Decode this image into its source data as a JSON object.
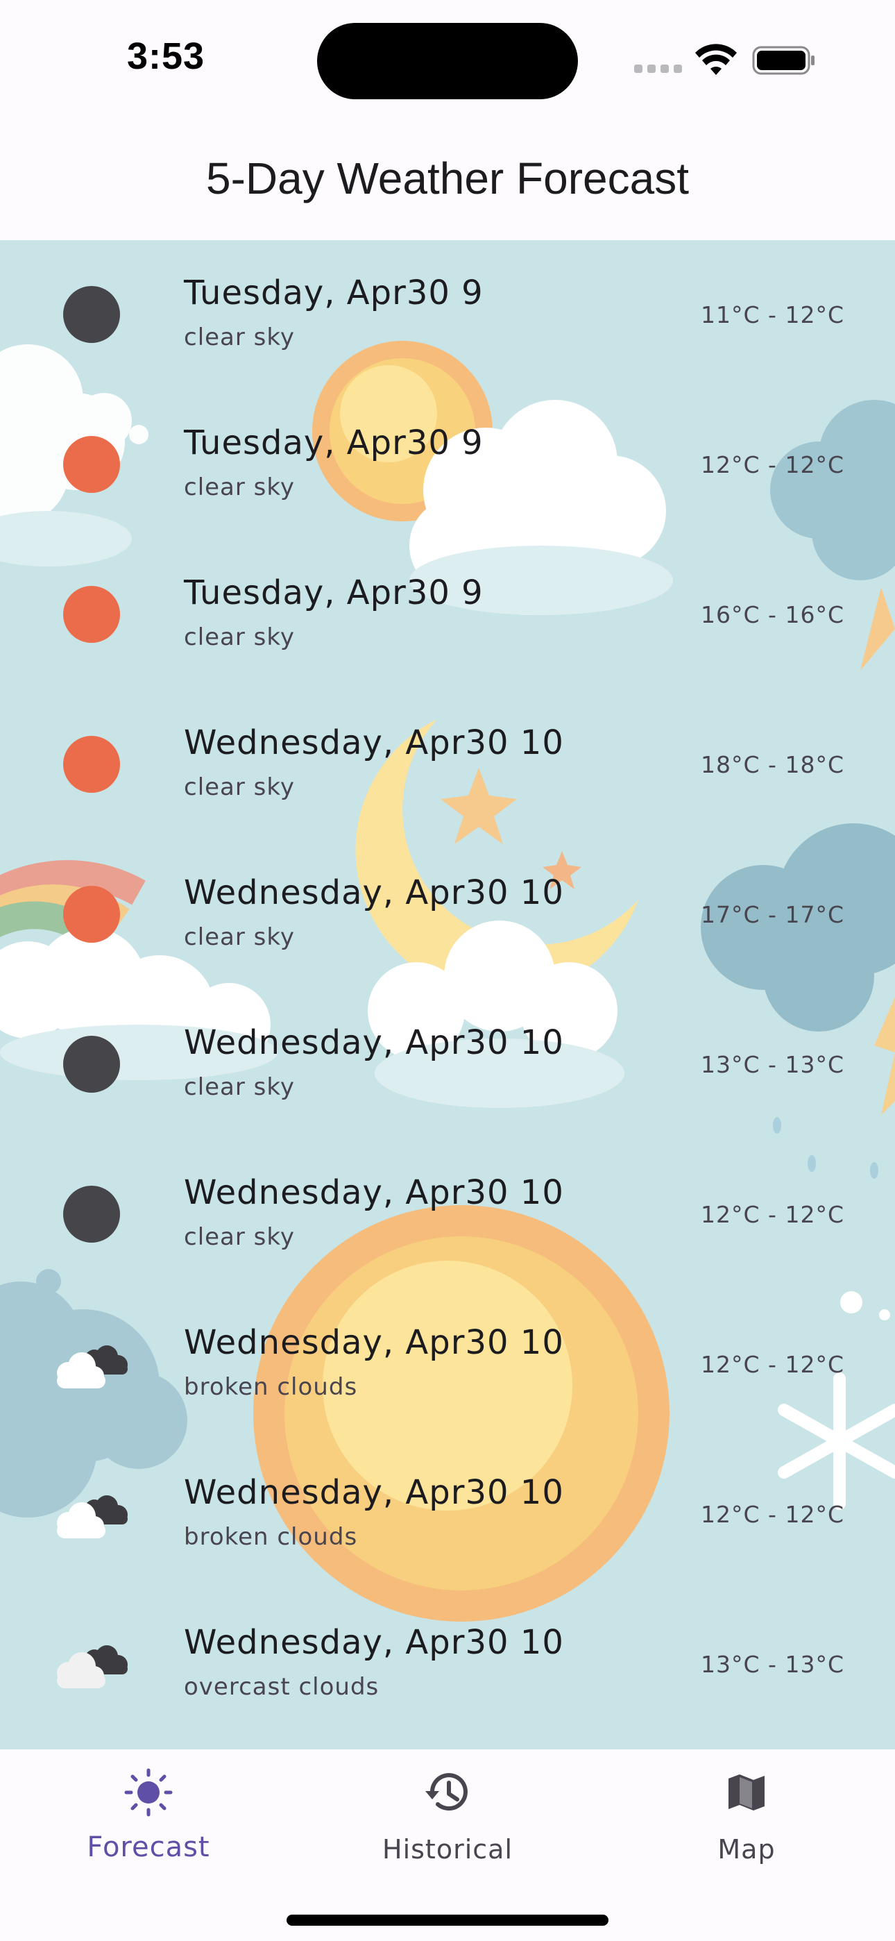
{
  "status_bar": {
    "time": "3:53"
  },
  "app_bar": {
    "title": "5-Day Weather Forecast"
  },
  "forecast": [
    {
      "title": "Tuesday, Apr30 9",
      "description": "clear sky",
      "temperature": "11°C - 12°C",
      "icon": "dark-dot-icon",
      "color": "#46454a"
    },
    {
      "title": "Tuesday, Apr30 9",
      "description": "clear sky",
      "temperature": "12°C - 12°C",
      "icon": "orange-dot-icon",
      "color": "#ea6c4b"
    },
    {
      "title": "Tuesday, Apr30 9",
      "description": "clear sky",
      "temperature": "16°C - 16°C",
      "icon": "orange-dot-icon",
      "color": "#ea6c4b"
    },
    {
      "title": "Wednesday, Apr30 10",
      "description": "clear sky",
      "temperature": "18°C - 18°C",
      "icon": "orange-dot-icon",
      "color": "#ea6c4b"
    },
    {
      "title": "Wednesday, Apr30 10",
      "description": "clear sky",
      "temperature": "17°C - 17°C",
      "icon": "orange-dot-icon",
      "color": "#ea6c4b"
    },
    {
      "title": "Wednesday, Apr30 10",
      "description": "clear sky",
      "temperature": "13°C - 13°C",
      "icon": "dark-dot-icon",
      "color": "#46454a"
    },
    {
      "title": "Wednesday, Apr30 10",
      "description": "clear sky",
      "temperature": "12°C - 12°C",
      "icon": "dark-dot-icon",
      "color": "#46454a"
    },
    {
      "title": "Wednesday, Apr30 10",
      "description": "broken clouds",
      "temperature": "12°C - 12°C",
      "icon": "broken-clouds-icon"
    },
    {
      "title": "Wednesday, Apr30 10",
      "description": "broken clouds",
      "temperature": "12°C - 12°C",
      "icon": "broken-clouds-icon"
    },
    {
      "title": "Wednesday, Apr30 10",
      "description": "overcast clouds",
      "temperature": "13°C - 13°C",
      "icon": "overcast-clouds-icon"
    }
  ],
  "bottom_nav": {
    "items": [
      {
        "label": "Forecast",
        "icon": "sun-icon",
        "active": true
      },
      {
        "label": "Historical",
        "icon": "history-icon",
        "active": false
      },
      {
        "label": "Map",
        "icon": "map-icon",
        "active": false
      }
    ]
  },
  "colors": {
    "accent": "#5f4fa7",
    "inactive": "#49454f",
    "content_background": "#c9e4e7"
  }
}
